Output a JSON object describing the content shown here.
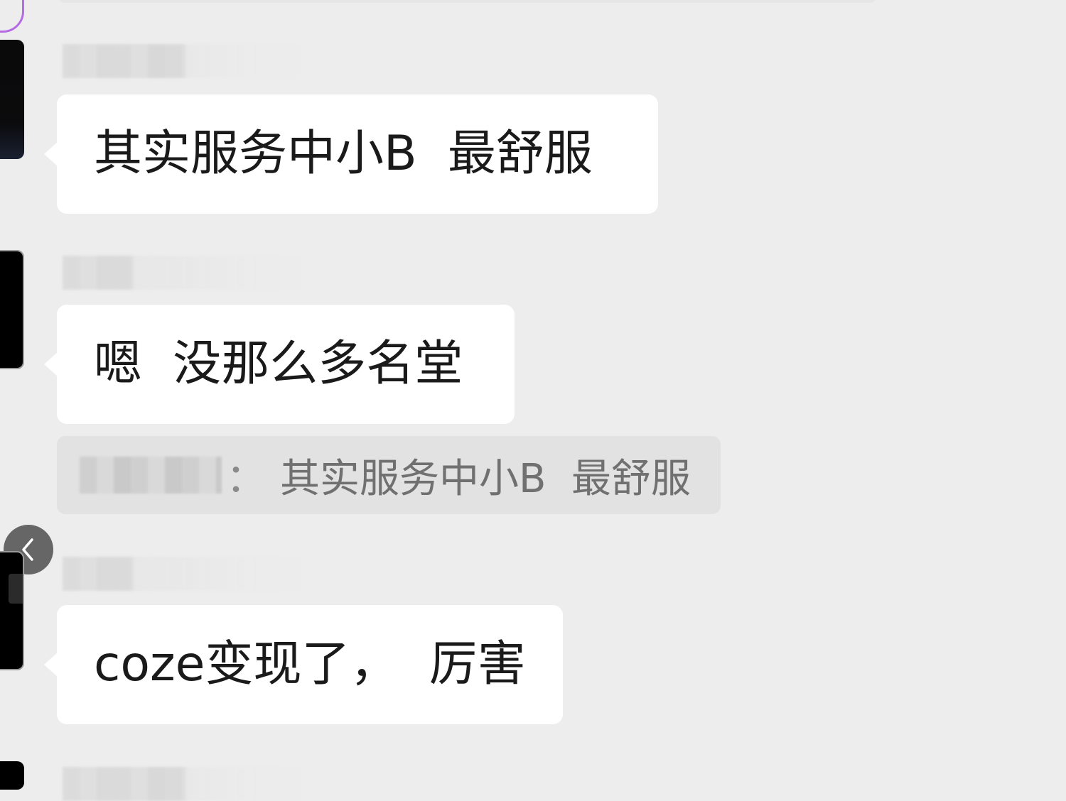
{
  "messages": [
    {
      "text": "其实服务中小B  最舒服"
    },
    {
      "text": "嗯  没那么多名堂"
    },
    {
      "text": "coze变现了，  厉害"
    }
  ],
  "quote": {
    "separator": "：",
    "text": "其实服务中小B  最舒服"
  },
  "icons": {
    "back": "chevron-left-icon"
  },
  "colors": {
    "background": "#ededed",
    "bubble": "#ffffff",
    "quote_background": "#e2e2e2",
    "quote_text": "#707070",
    "avatar_ring": "#b46be3"
  }
}
